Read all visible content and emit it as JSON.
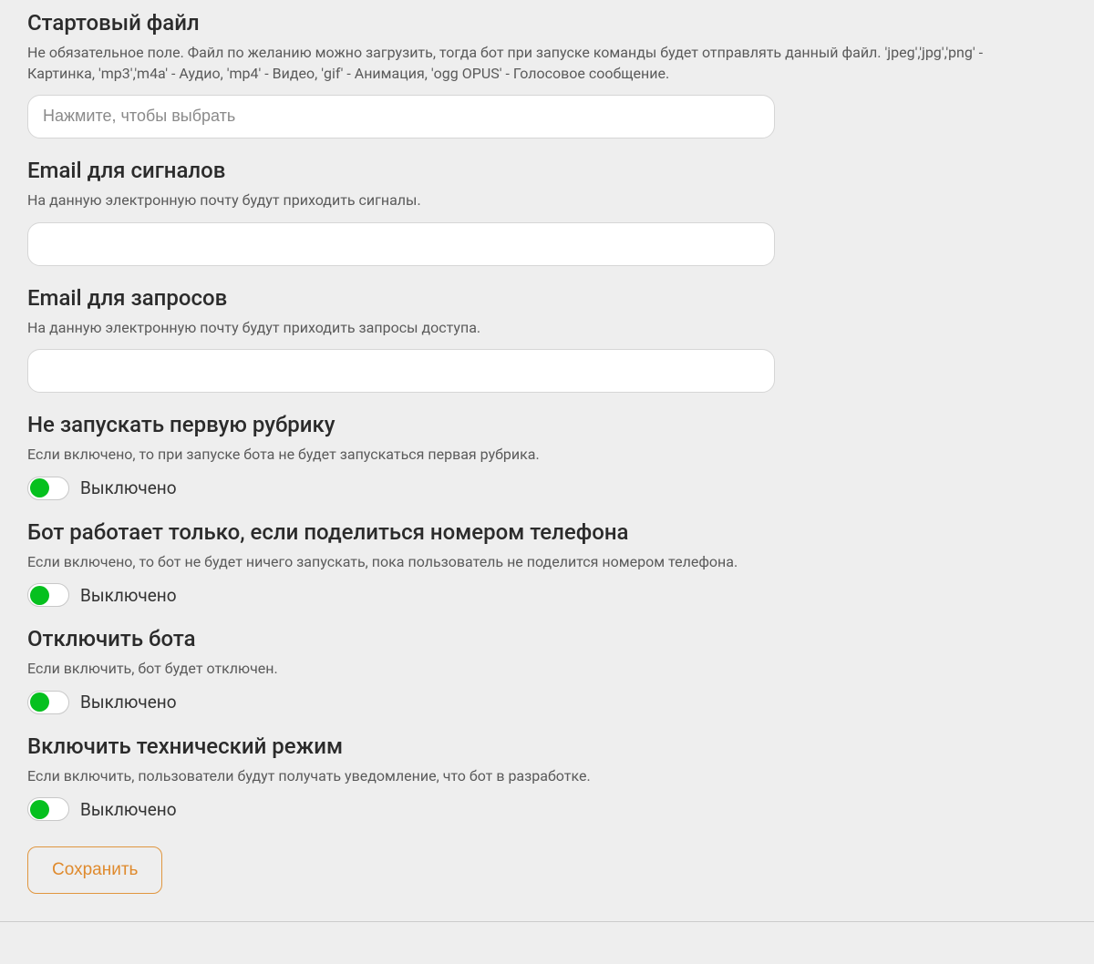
{
  "fields": {
    "startFile": {
      "title": "Стартовый файл",
      "desc": "Не обязательное поле. Файл по желанию можно загрузить, тогда бот при запуске команды будет отправлять данный файл. 'jpeg','jpg','png' - Картинка, 'mp3','m4a' - Аудио, 'mp4' - Видео, 'gif' - Анимация, 'ogg OPUS' - Голосовое сообщение.",
      "placeholder": "Нажмите, чтобы выбрать",
      "value": ""
    },
    "emailSignals": {
      "title": "Email для сигналов",
      "desc": "На данную электронную почту будут приходить сигналы.",
      "value": ""
    },
    "emailRequests": {
      "title": "Email для запросов",
      "desc": "На данную электронную почту будут приходить запросы доступа.",
      "value": ""
    },
    "noFirstRubric": {
      "title": "Не запускать первую рубрику",
      "desc": "Если включено, то при запуске бота не будет запускаться первая рубрика.",
      "stateLabel": "Выключено"
    },
    "phoneRequired": {
      "title": "Бот работает только, если поделиться номером телефона",
      "desc": "Если включено, то бот не будет ничего запускать, пока пользователь не поделится номером телефона.",
      "stateLabel": "Выключено"
    },
    "disableBot": {
      "title": "Отключить бота",
      "desc": "Если включить, бот будет отключен.",
      "stateLabel": "Выключено"
    },
    "techMode": {
      "title": "Включить технический режим",
      "desc": "Если включить, пользователи будут получать уведомление, что бот в разработке.",
      "stateLabel": "Выключено"
    }
  },
  "buttons": {
    "save": "Сохранить"
  },
  "colors": {
    "accent": "#df8a2d",
    "toggleOn": "#05c01e",
    "background": "#eeeeee"
  }
}
